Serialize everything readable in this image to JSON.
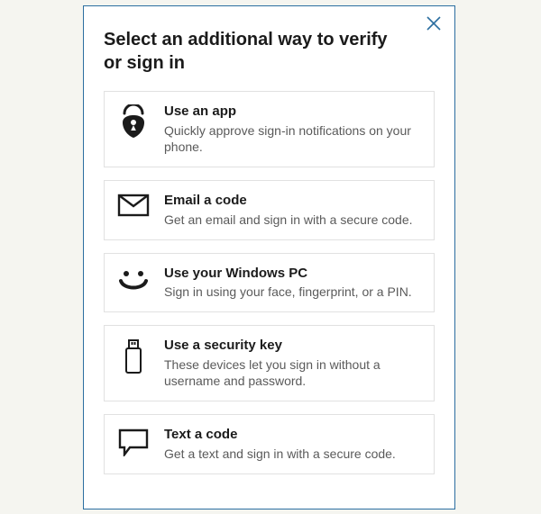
{
  "dialog": {
    "title": "Select an additional way to verify or sign in"
  },
  "options": [
    {
      "title": "Use an app",
      "desc": "Quickly approve sign-in notifications on your phone."
    },
    {
      "title": "Email a code",
      "desc": "Get an email and sign in with a secure code."
    },
    {
      "title": "Use your Windows PC",
      "desc": "Sign in using your face, fingerprint, or a PIN."
    },
    {
      "title": "Use a security key",
      "desc": "These devices let you sign in without a username and password."
    },
    {
      "title": "Text a code",
      "desc": "Get a text and sign in with a secure code."
    }
  ]
}
